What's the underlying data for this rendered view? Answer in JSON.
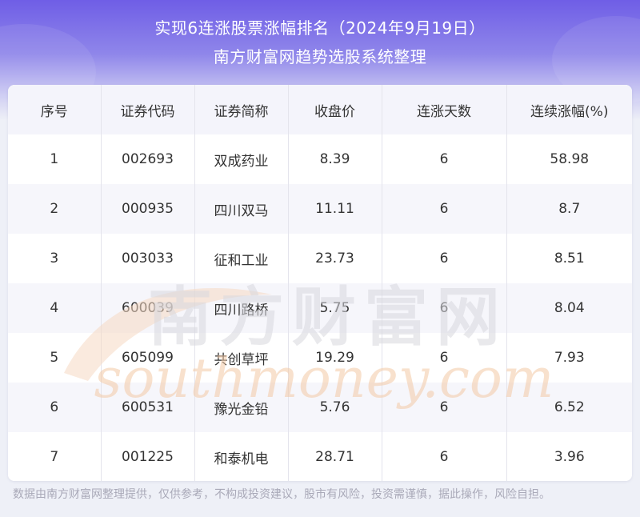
{
  "header": {
    "title_line1": "实现6连涨股票涨幅排名（2024年9月19日）",
    "title_line2": "南方财富网趋势选股系统整理"
  },
  "table": {
    "columns": [
      "序号",
      "证券代码",
      "证券简称",
      "收盘价",
      "连涨天数",
      "连续涨幅(%)"
    ],
    "rows": [
      [
        "1",
        "002693",
        "双成药业",
        "8.39",
        "6",
        "58.98"
      ],
      [
        "2",
        "000935",
        "四川双马",
        "11.11",
        "6",
        "8.7"
      ],
      [
        "3",
        "003033",
        "征和工业",
        "23.73",
        "6",
        "8.51"
      ],
      [
        "4",
        "600039",
        "四川路桥",
        "5.75",
        "6",
        "8.04"
      ],
      [
        "5",
        "605099",
        "共创草坪",
        "19.29",
        "6",
        "7.93"
      ],
      [
        "6",
        "600531",
        "豫光金铅",
        "5.76",
        "6",
        "6.52"
      ],
      [
        "7",
        "001225",
        "和泰机电",
        "28.71",
        "6",
        "3.96"
      ]
    ]
  },
  "watermark": {
    "brand_cn": "南方财富网",
    "brand_en": "southmoney.com"
  },
  "footer": {
    "disclaimer": "数据由南方财富网整理提供，仅供参考，不构成投资建议，股市有风险，投资需谨慎，据此操作，风险自担。"
  },
  "colors": {
    "header_top": "#6f5ee6",
    "header_bottom": "#eef0f7",
    "text": "#333333",
    "footer_text": "#a9a9b8"
  }
}
